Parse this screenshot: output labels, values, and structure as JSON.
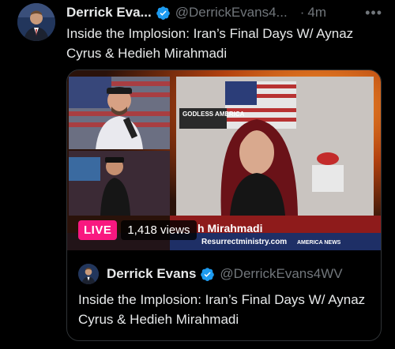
{
  "post": {
    "author_name": "Derrick Eva...",
    "handle": "@DerrickEvans4...",
    "separator": "·",
    "time": "4m",
    "more_icon": "ellipsis-icon",
    "verified_icon": "verified-badge-icon",
    "text": "Inside the Implosion: Iran’s Final Days W/ Aynaz Cyrus & Hedieh Mirahmadi"
  },
  "media": {
    "live_label": "LIVE",
    "views": "1,418 views",
    "lower_third_name": "h Mirahmadi",
    "lower_third_site": "Resurrectministry.com",
    "lower_third_brand": "AMERICA NEWS",
    "sign_text": "GODLESS AMERICA"
  },
  "quoted": {
    "author_name": "Derrick Evans",
    "handle": "@DerrickEvans4WV",
    "text": "Inside the Implosion: Iran’s Final Days W/ Aynaz Cyrus & Hedieh Mirahmadi"
  },
  "colors": {
    "background": "#000000",
    "text": "#e7e9ea",
    "muted": "#71767b",
    "verified": "#1d9bf0",
    "live": "#f91880",
    "border": "#2f3336"
  }
}
